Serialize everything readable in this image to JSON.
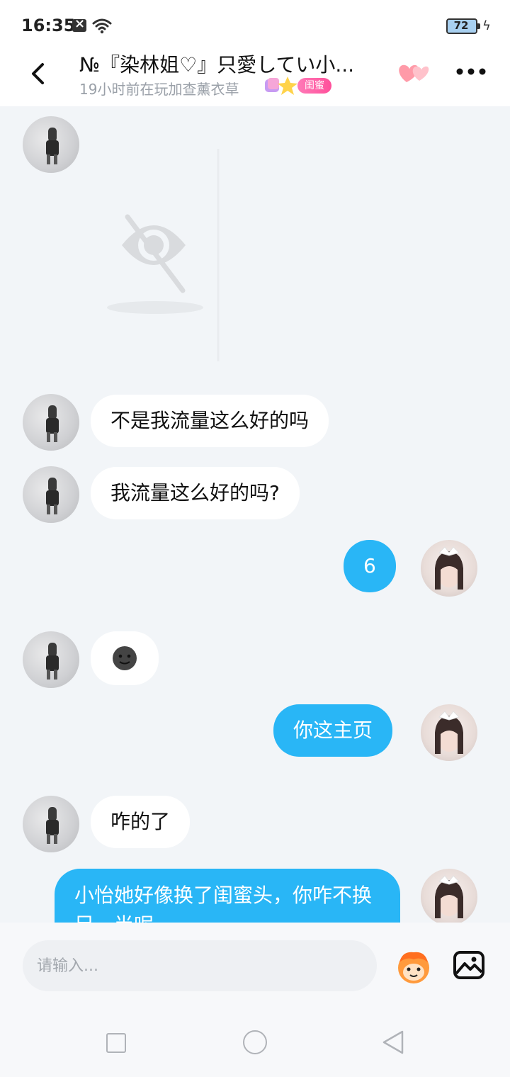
{
  "status_bar": {
    "time": "16:35",
    "battery": "72"
  },
  "header": {
    "title": "№『染林姐♡』只愛してい小...",
    "subtitle": "19小时前在玩加查薰衣草",
    "relation_tag": "闺蜜",
    "icons": [
      "back-icon",
      "hearts-icon",
      "more-icon"
    ]
  },
  "messages": [
    {
      "sender": "other",
      "type": "image",
      "content": "hidden-image"
    },
    {
      "sender": "other",
      "type": "text",
      "text": "不是我流量这么好的吗"
    },
    {
      "sender": "other",
      "type": "text",
      "text": "我流量这么好的吗?"
    },
    {
      "sender": "self",
      "type": "text",
      "text": "6"
    },
    {
      "sender": "other",
      "type": "emoji",
      "content": "dark-face-emoji"
    },
    {
      "sender": "self",
      "type": "text",
      "text": "你这主页"
    },
    {
      "sender": "other",
      "type": "text",
      "text": "咋的了"
    },
    {
      "sender": "self",
      "type": "text",
      "text": "小怡她好像换了闺蜜头，你咋不换另一半呢"
    }
  ],
  "composer": {
    "placeholder": "请输入..."
  },
  "colors": {
    "accent": "#29b6f6",
    "chat_bg": "#f2f5f8",
    "tag_pink": "#ff4f9a"
  }
}
